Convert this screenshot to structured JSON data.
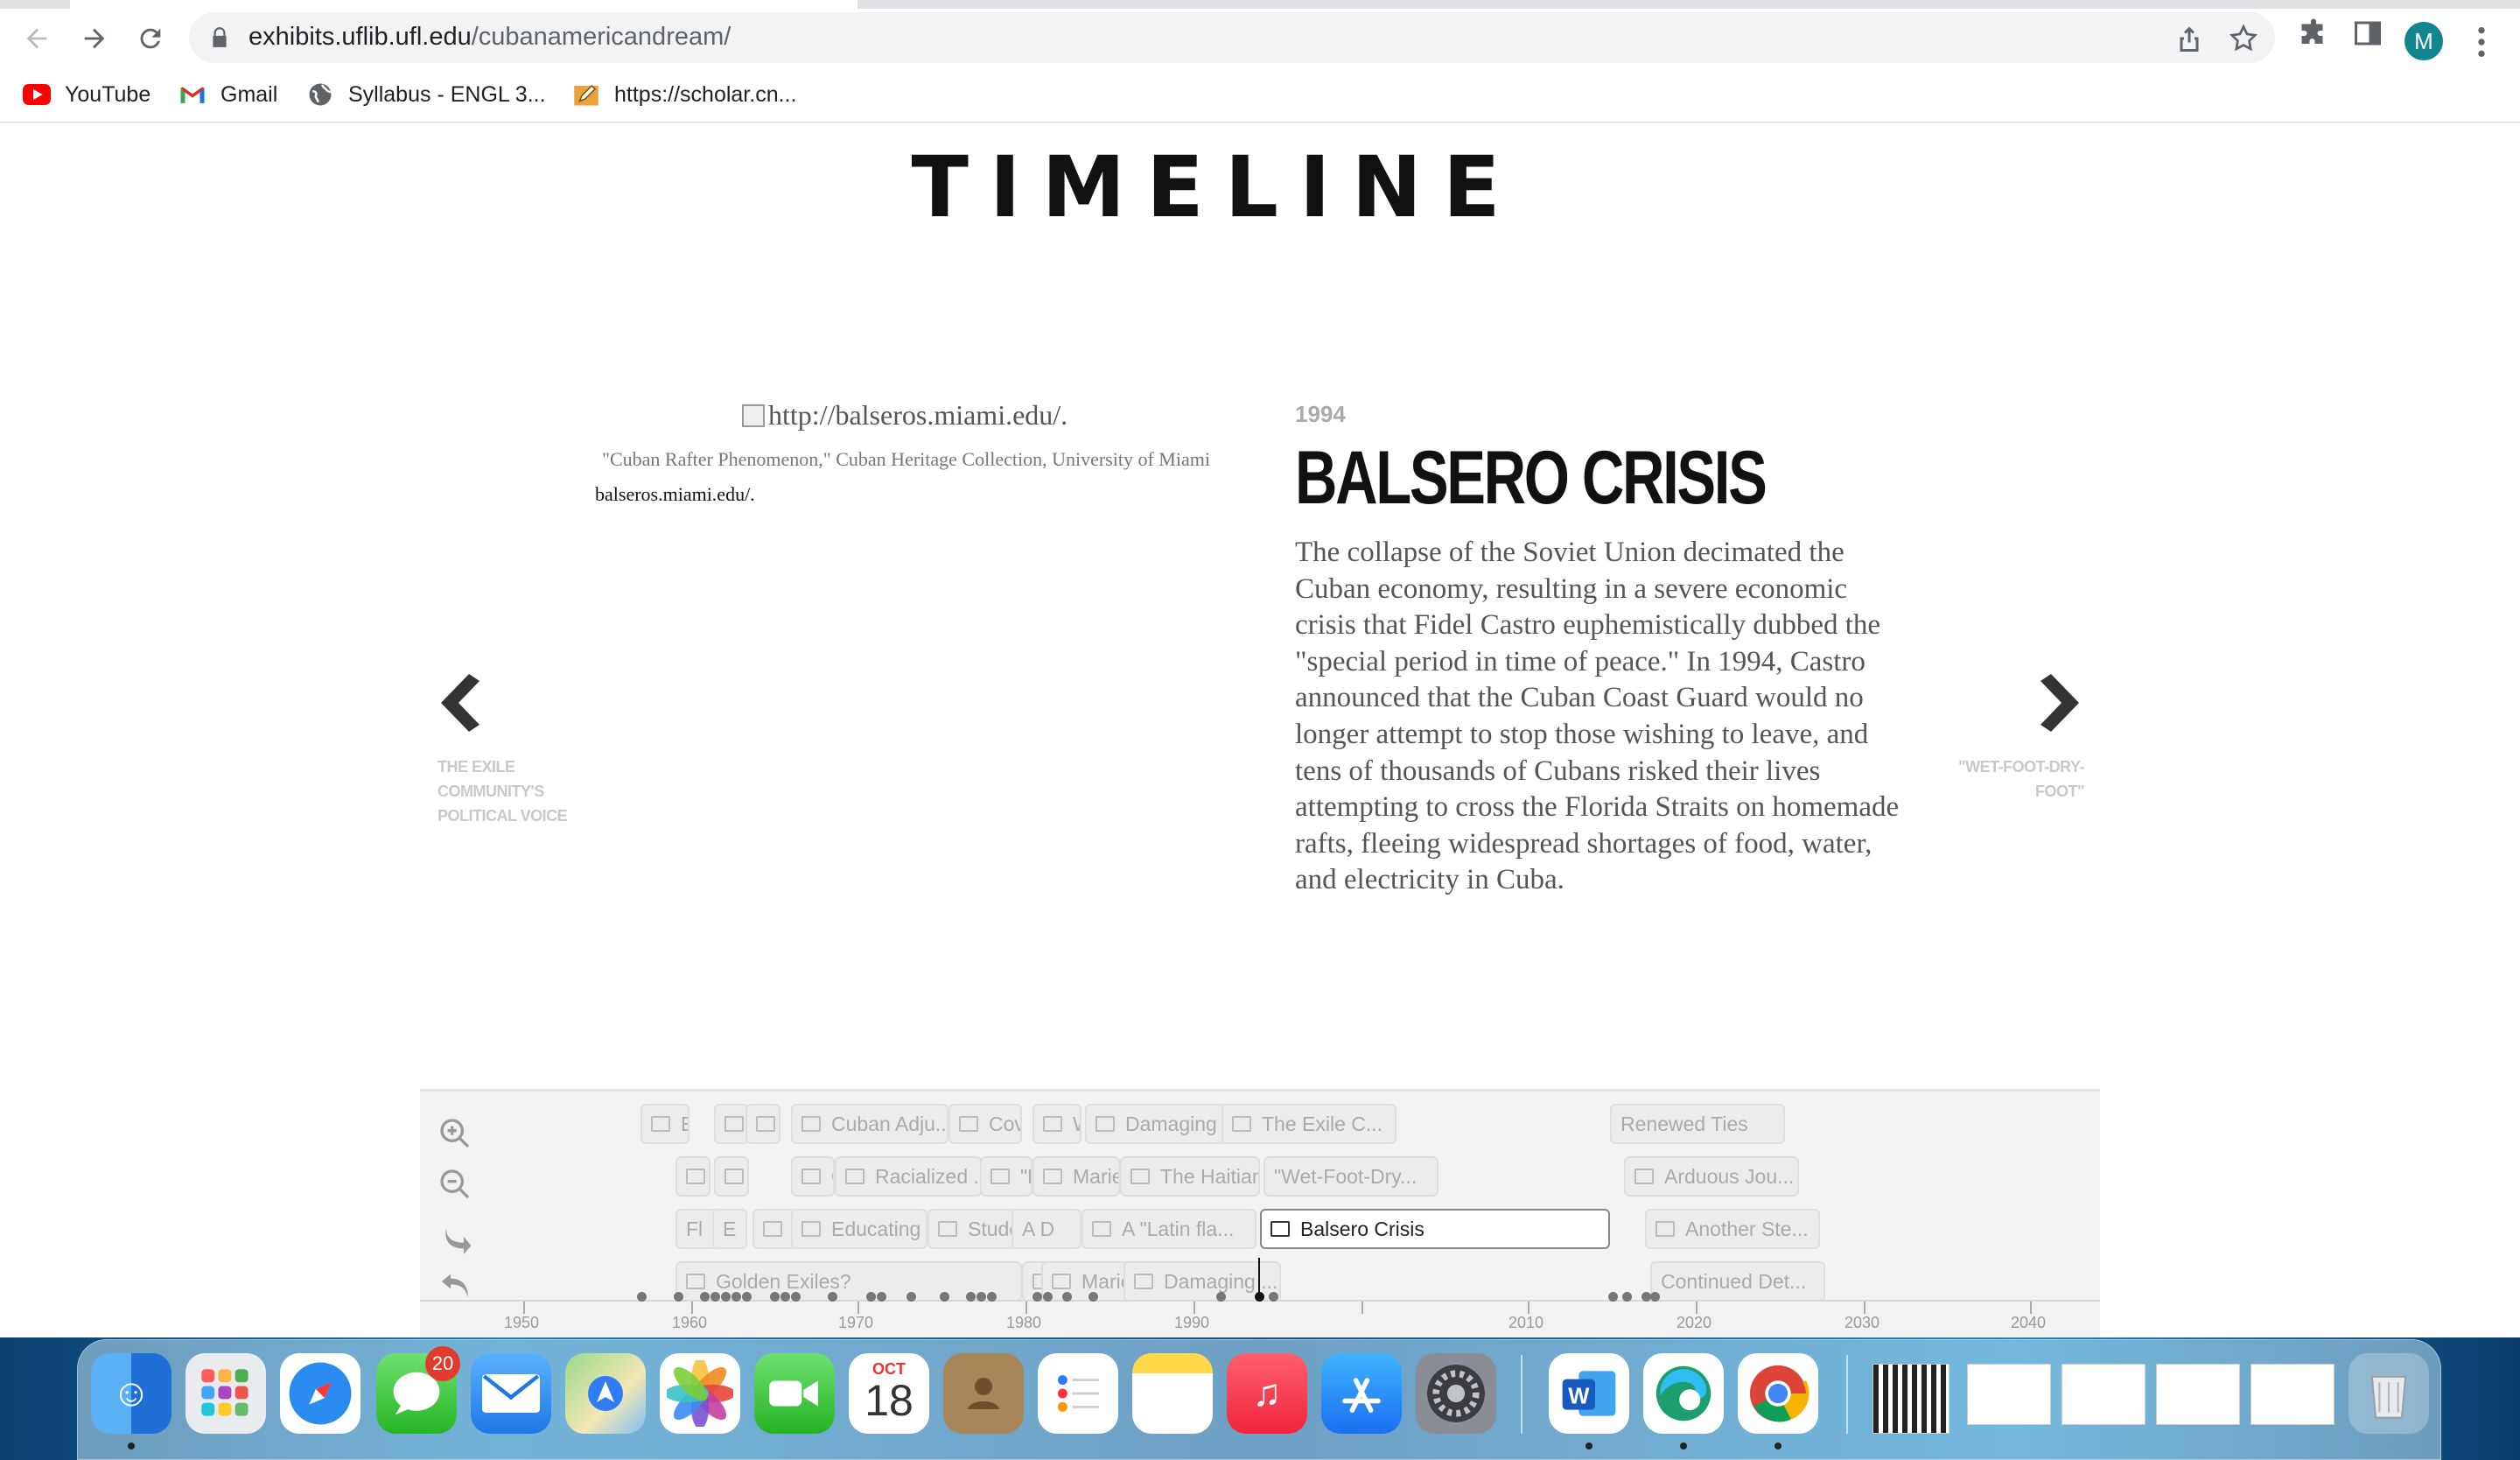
{
  "browser": {
    "url_host": "exhibits.uflib.ufl.edu",
    "url_path": "/cubanamericandream/",
    "profile_initial": "M",
    "bookmarks": [
      {
        "label": "YouTube",
        "icon": "youtube-icon"
      },
      {
        "label": "Gmail",
        "icon": "gmail-icon"
      },
      {
        "label": "Syllabus - ENGL 3...",
        "icon": "globe-icon"
      },
      {
        "label": "https://scholar.cn...",
        "icon": "pencil-icon"
      }
    ]
  },
  "page": {
    "title": "TIMELINE",
    "media": {
      "image_alt": "http://balseros.miami.edu/.",
      "caption": "\"Cuban Rafter Phenomenon,\" Cuban Heritage Collection, University of Miami",
      "credit": "balseros.miami.edu/."
    },
    "slide": {
      "year": "1994",
      "headline": "BALSERO CRISIS",
      "body": "The collapse of the Soviet Union decimated the Cuban economy, resulting in a severe economic crisis that Fidel Castro euphemistically dubbed the \"special period in time of peace.\" In 1994, Castro announced that the Cuban Coast Guard would no longer attempt to stop those wishing to leave, and tens of thousands of Cubans risked their lives attempting to cross the Florida Straits on homemade rafts, fleeing widespread shortages of food, water, and electricity in Cuba."
    },
    "prev": {
      "label": "THE EXILE COMMUNITY'S POLITICAL VOICE"
    },
    "next": {
      "label": "\"WET-FOOT-DRY-FOOT\""
    }
  },
  "timeline": {
    "active_marker": "Balsero Crisis",
    "markers": [
      {
        "label": "Ec"
      },
      {
        "label": ""
      },
      {
        "label": ""
      },
      {
        "label": "Cuban Adju..."
      },
      {
        "label": "Cove"
      },
      {
        "label": "W"
      },
      {
        "label": "Damaging S"
      },
      {
        "label": "The Exile C..."
      },
      {
        "label": "Renewed Ties"
      },
      {
        "label": "I"
      },
      {
        "label": ""
      },
      {
        "label": "C"
      },
      {
        "label": "Racialized ."
      },
      {
        "label": "\"E"
      },
      {
        "label": "Marie"
      },
      {
        "label": "The Haitian"
      },
      {
        "label": "\"Wet-Foot-Dry..."
      },
      {
        "label": "Arduous Jou..."
      },
      {
        "label": "Fl"
      },
      {
        "label": "E"
      },
      {
        "label": ""
      },
      {
        "label": "Educating"
      },
      {
        "label": "Student"
      },
      {
        "label": "A D"
      },
      {
        "label": "A \"Latin fla..."
      },
      {
        "label": "Another Ste..."
      },
      {
        "label": "Golden Exiles?"
      },
      {
        "label": ""
      },
      {
        "label": "Mariel E"
      },
      {
        "label": "Damaging ..."
      },
      {
        "label": "Continued Det..."
      }
    ],
    "axis_labels": [
      "1950",
      "1960",
      "1970",
      "1980",
      "1990",
      "2010",
      "2020",
      "2030",
      "2040"
    ]
  },
  "dock": {
    "messages_badge": "20",
    "calendar_month": "OCT",
    "calendar_day": "18",
    "apps": [
      "finder",
      "launchpad",
      "safari",
      "messages",
      "mail",
      "maps",
      "photos",
      "facetime",
      "calendar",
      "contacts",
      "reminders",
      "notes",
      "music",
      "app-store",
      "system-preferences",
      "word",
      "edge",
      "chrome"
    ]
  },
  "colors": {
    "page_bg": "#ffffff",
    "headline": "#111111",
    "body": "#555555",
    "nav_label": "#c9c9c9",
    "profile": "#11868f"
  }
}
